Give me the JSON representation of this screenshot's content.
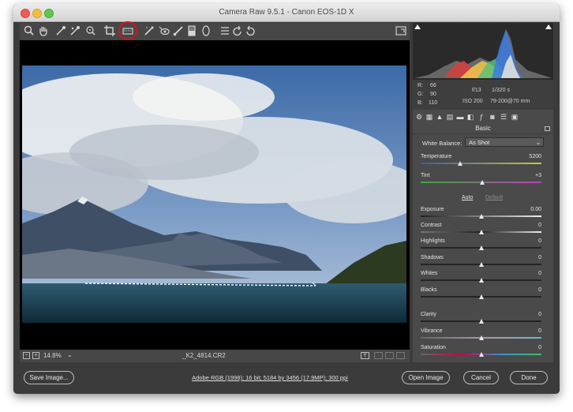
{
  "window": {
    "title": "Camera Raw 9.5.1  -  Canon EOS-1D X"
  },
  "toolbar": {
    "tools": [
      "zoom-tool-icon",
      "hand-tool-icon",
      "white-balance-tool-icon",
      "color-sampler-tool-icon",
      "targeted-adjustment-tool-icon",
      "crop-tool-icon",
      "straighten-tool-icon",
      "spot-removal-tool-icon",
      "red-eye-removal-tool-icon",
      "adjustment-brush-icon",
      "graduated-filter-icon",
      "radial-filter-icon",
      "preferences-icon",
      "rotate-ccw-icon",
      "rotate-cw-icon"
    ],
    "highlighted_tool": "straighten-tool-icon"
  },
  "statusbar": {
    "zoom": "14.8%",
    "filename": "_K2_4814.CR2"
  },
  "histogram_info": {
    "r_label": "R:",
    "r_value": "66",
    "g_label": "G:",
    "g_value": "90",
    "b_label": "B:",
    "b_value": "110",
    "aperture": "f/13",
    "shutter": "1/320 s",
    "iso": "ISO 200",
    "lens": "79-200@70 mm"
  },
  "panel": {
    "title": "Basic",
    "white_balance_label": "White Balance:",
    "white_balance_value": "As Shot",
    "auto_label": "Auto",
    "default_label": "Default",
    "sliders": [
      {
        "label": "Temperature",
        "value": "5200",
        "position": 0.33
      },
      {
        "label": "Tint",
        "value": "+3",
        "position": 0.51
      },
      {
        "label": "Exposure",
        "value": "0.00",
        "position": 0.5
      },
      {
        "label": "Contrast",
        "value": "0",
        "position": 0.5
      },
      {
        "label": "Highlights",
        "value": "0",
        "position": 0.5
      },
      {
        "label": "Shadows",
        "value": "0",
        "position": 0.5
      },
      {
        "label": "Whites",
        "value": "0",
        "position": 0.5
      },
      {
        "label": "Blacks",
        "value": "0",
        "position": 0.5
      },
      {
        "label": "Clarity",
        "value": "0",
        "position": 0.5
      },
      {
        "label": "Vibrance",
        "value": "0",
        "position": 0.5
      },
      {
        "label": "Saturation",
        "value": "0",
        "position": 0.5
      }
    ]
  },
  "bottom": {
    "save_label": "Save Image...",
    "workflow_link": "Adobe RGB (1998); 16 bit; 5184 by 3456 (17.9MP); 300 ppi",
    "open_label": "Open Image",
    "cancel_label": "Cancel",
    "done_label": "Done"
  },
  "colors": {
    "highlight_ring": "#d6141b",
    "panel_bg": "#4a4a4a",
    "window_bg": "#3b3b3b"
  }
}
